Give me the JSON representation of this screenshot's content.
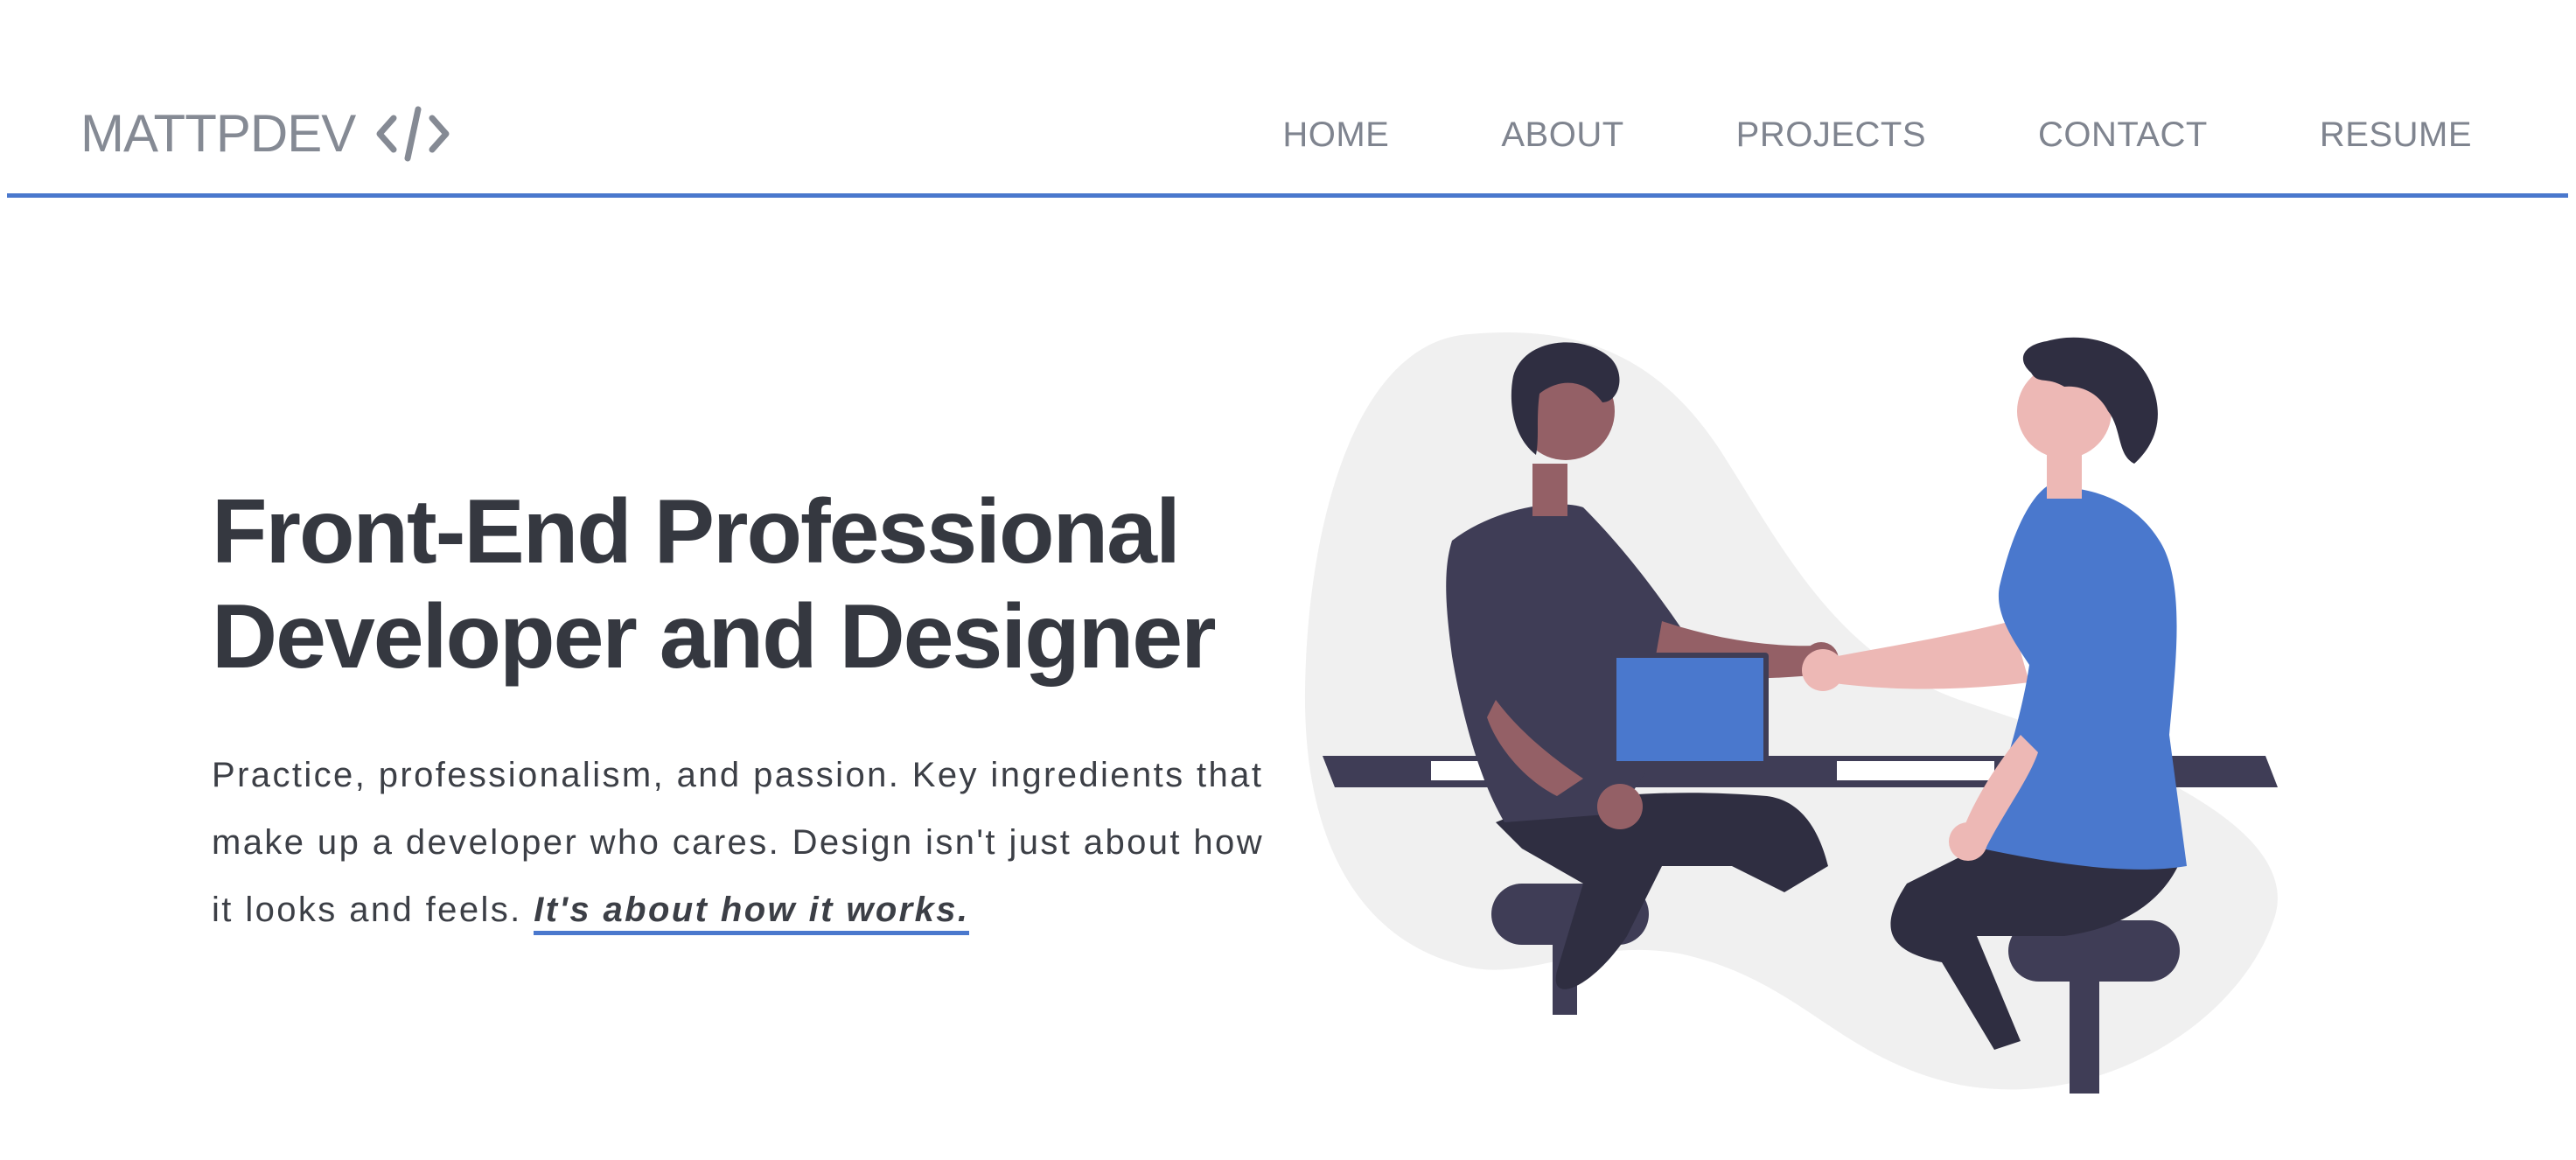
{
  "header": {
    "brand": "MATTPDEV",
    "brand_icon": "code-brackets-icon",
    "nav": [
      {
        "label": "HOME"
      },
      {
        "label": "ABOUT"
      },
      {
        "label": "PROJECTS"
      },
      {
        "label": "CONTACT"
      },
      {
        "label": "RESUME"
      }
    ]
  },
  "hero": {
    "title_line1": "Front-End Professional",
    "title_line2": "Developer and Designer",
    "description": "Practice, professionalism, and passion. Key ingredients that make up a developer who cares. Design isn't just about how it looks and feels. ",
    "emphasis": "It's about how it works."
  },
  "illustration": {
    "icon": "handshake-illustration"
  },
  "colors": {
    "accent": "#4a78cd",
    "title": "#353840",
    "nav": "#7f848f",
    "blob": "#f0f0f0",
    "dark": "#2f2e41",
    "skin_dark": "#946066",
    "skin_light": "#edb8b5"
  }
}
